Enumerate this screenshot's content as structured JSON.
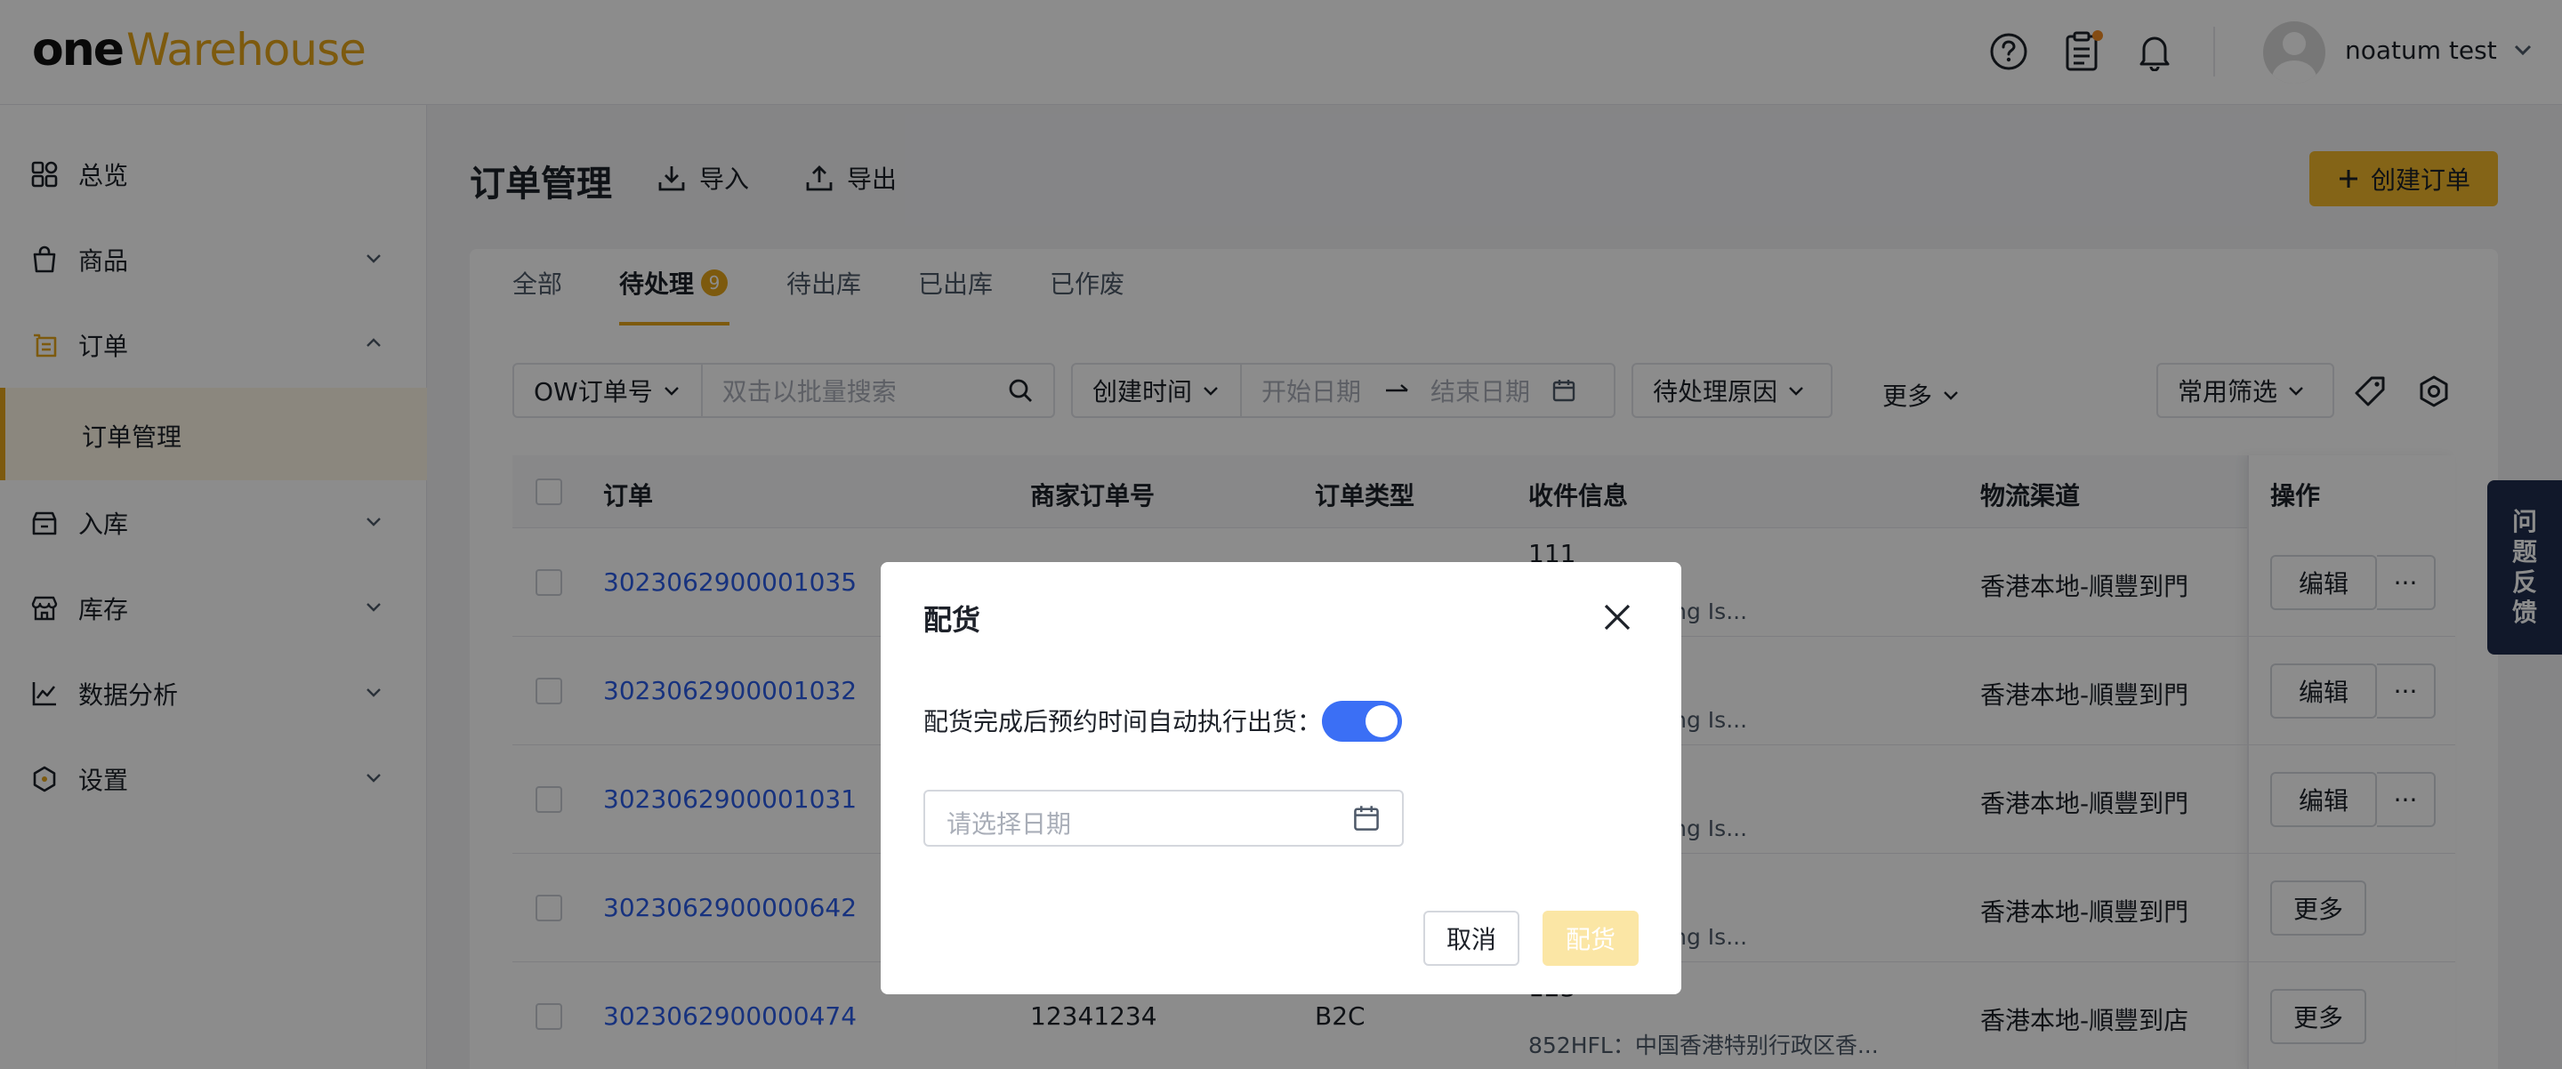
{
  "header": {
    "logo_one": "one",
    "logo_warehouse": "Warehouse",
    "username": "noatum test",
    "icons": [
      "help-icon",
      "clipboard-icon",
      "bell-icon"
    ]
  },
  "sidebar": {
    "items": [
      {
        "label": "总览",
        "icon": "grid-icon"
      },
      {
        "label": "商品",
        "icon": "bag-icon"
      },
      {
        "label": "订单",
        "icon": "order-icon"
      },
      {
        "label": "订单管理"
      },
      {
        "label": "入库",
        "icon": "inbound-icon"
      },
      {
        "label": "库存",
        "icon": "store-icon"
      },
      {
        "label": "数据分析",
        "icon": "chart-icon"
      },
      {
        "label": "设置",
        "icon": "settings-hex-icon"
      }
    ]
  },
  "main": {
    "title": "订单管理",
    "import_label": "导入",
    "export_label": "导出",
    "create_label": "创建订单",
    "tabs": [
      {
        "label": "全部"
      },
      {
        "label": "待处理",
        "badge": "9"
      },
      {
        "label": "待出库"
      },
      {
        "label": "已出库"
      },
      {
        "label": "已作废"
      }
    ],
    "filters": {
      "order_field": "OW订单号",
      "search_placeholder": "双击以批量搜索",
      "time_field": "创建时间",
      "start_placeholder": "开始日期",
      "end_placeholder": "结束日期",
      "reason": "待处理原因",
      "more": "更多",
      "common": "常用筛选"
    },
    "table": {
      "headers": [
        "订单",
        "商家订单号",
        "订单类型",
        "收件信息",
        "物流渠道",
        "操作"
      ],
      "rows": [
        {
          "order": "3023062900001035",
          "merchant": "",
          "type": "",
          "name": "111",
          "addr": "政区 Hong Kong Is...",
          "channel": "香港本地-順豐到門",
          "actions": [
            "编辑",
            "···"
          ]
        },
        {
          "order": "3023062900001032",
          "merchant": "",
          "type": "",
          "name": "",
          "addr": "政区 Hong Kong Is...",
          "channel": "香港本地-順豐到門",
          "actions": [
            "编辑",
            "···"
          ]
        },
        {
          "order": "3023062900001031",
          "merchant": "",
          "type": "",
          "name": "",
          "addr": "政区 Hong Kong Is...",
          "channel": "香港本地-順豐到門",
          "actions": [
            "编辑",
            "···"
          ]
        },
        {
          "order": "3023062900000642",
          "merchant": "",
          "type": "",
          "name": "",
          "addr": "政区 Hong Kong Is...",
          "channel": "香港本地-順豐到門",
          "actions": [
            "更多"
          ]
        },
        {
          "order": "3023062900000474",
          "merchant": "12341234",
          "type": "B2C",
          "name": "123",
          "addr": "852HFL：中国香港特别行政区香...",
          "channel": "香港本地-順豐到店",
          "actions": [
            "更多"
          ]
        }
      ]
    },
    "feedback": [
      "问",
      "题",
      "反",
      "馈"
    ]
  },
  "modal": {
    "title": "配货",
    "switch_label": "配货完成后预约时间自动执行出货：",
    "switch_on": true,
    "date_placeholder": "请选择日期",
    "cancel": "取消",
    "confirm": "配货"
  },
  "colors": {
    "brand_gold": "#e3a41b",
    "link_blue": "#2b5ce6",
    "switch_blue": "#3b6ff5",
    "feedback_navy": "#1f2d4d"
  }
}
